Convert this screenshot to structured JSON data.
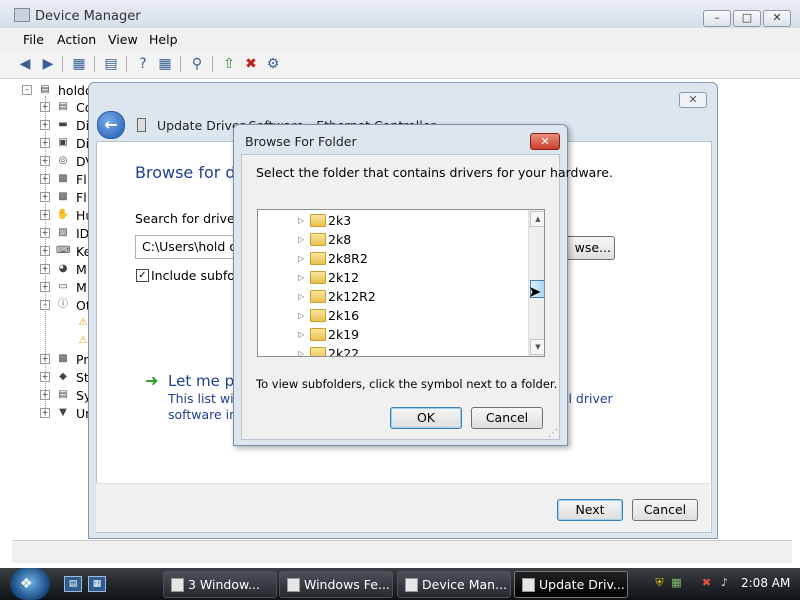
{
  "device_manager": {
    "title": "Device Manager",
    "menu": [
      "File",
      "Action",
      "View",
      "Help"
    ],
    "tree_root": "holdo",
    "tree_items": [
      {
        "label": "Co",
        "icon": "computer-icon"
      },
      {
        "label": "Di",
        "icon": "disk-drive-icon"
      },
      {
        "label": "Di",
        "icon": "display-adapter-icon"
      },
      {
        "label": "DV",
        "icon": "dvd-drive-icon"
      },
      {
        "label": "Fl",
        "icon": "floppy-controller-icon"
      },
      {
        "label": "Fl",
        "icon": "floppy-drive-icon"
      },
      {
        "label": "Hu",
        "icon": "hid-icon"
      },
      {
        "label": "ID",
        "icon": "ide-controller-icon"
      },
      {
        "label": "Ke",
        "icon": "keyboard-icon"
      },
      {
        "label": "M",
        "icon": "mouse-icon"
      },
      {
        "label": "M",
        "icon": "monitor-icon"
      },
      {
        "label": "Ot",
        "icon": "other-devices-icon"
      },
      {
        "label": "",
        "icon": "warning-device-icon"
      },
      {
        "label": "",
        "icon": "warning-device-icon"
      },
      {
        "label": "Pr",
        "icon": "processor-icon"
      },
      {
        "label": "St",
        "icon": "storage-icon"
      },
      {
        "label": "Sy",
        "icon": "system-device-icon"
      },
      {
        "label": "Ur",
        "icon": "usb-icon"
      }
    ]
  },
  "update_dialog": {
    "title": "Update Driver Software - Ethernet Controller",
    "heading": "Browse for dri",
    "search_label": "Search for driver so",
    "path_value": "C:\\Users\\hold on",
    "browse_label": "wse...",
    "include_subfolders_label": "Include subfold",
    "include_subfolders_checked": true,
    "let_me_pick": "Let me pi",
    "desc_line1": "This list will s",
    "desc_line2": "software in t",
    "desc_line1_end": "ll driver",
    "next_label": "Next",
    "cancel_label": "Cancel"
  },
  "browse_dialog": {
    "title": "Browse For Folder",
    "instruction": "Select the folder that contains drivers for your hardware.",
    "folders": [
      "2k3",
      "2k8",
      "2k8R2",
      "2k12",
      "2k12R2",
      "2k16",
      "2k19",
      "2k22"
    ],
    "hint": "To view subfolders, click the symbol next to a folder.",
    "ok_label": "OK",
    "cancel_label": "Cancel"
  },
  "taskbar": {
    "tasks": [
      {
        "label": "3 Window...",
        "active": false
      },
      {
        "label": "Windows Fe...",
        "active": false
      },
      {
        "label": "Device Man...",
        "active": false
      },
      {
        "label": "Update Driv...",
        "active": true
      }
    ],
    "clock": "2:08 AM"
  }
}
